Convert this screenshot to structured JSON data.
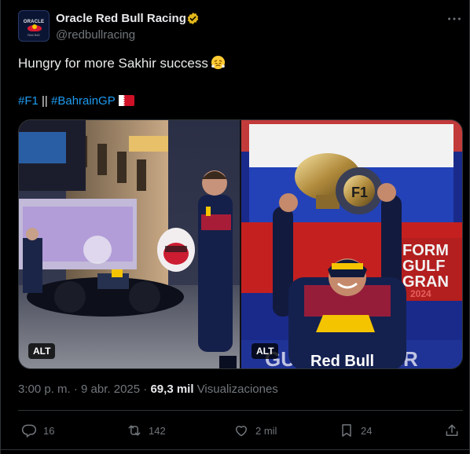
{
  "author": {
    "name": "Oracle Red Bull Racing",
    "handle": "@redbullracing",
    "avatar_text": "ORACLE",
    "avatar_sub": "RACING"
  },
  "tweet": {
    "text": "Hungry for more Sakhir success",
    "emoji": "face-with-steam-emoji",
    "hashtag_1": "#F1",
    "separator": " || ",
    "hashtag_2": "#BahrainGP",
    "flag": "bahrain-flag"
  },
  "media": {
    "left_alt": "ALT",
    "right_alt": "ALT"
  },
  "meta": {
    "time": "3:00 p. m.",
    "dot": " · ",
    "date": "9 abr. 2025",
    "views_count": "69,3 mil",
    "views_label": "Visualizaciones"
  },
  "actions": {
    "replies": "16",
    "reposts": "142",
    "likes": "2 mil",
    "bookmarks": "24"
  },
  "colors": {
    "accent": "#1d9bf0",
    "muted": "#71767b",
    "verified": "#e2b719"
  }
}
